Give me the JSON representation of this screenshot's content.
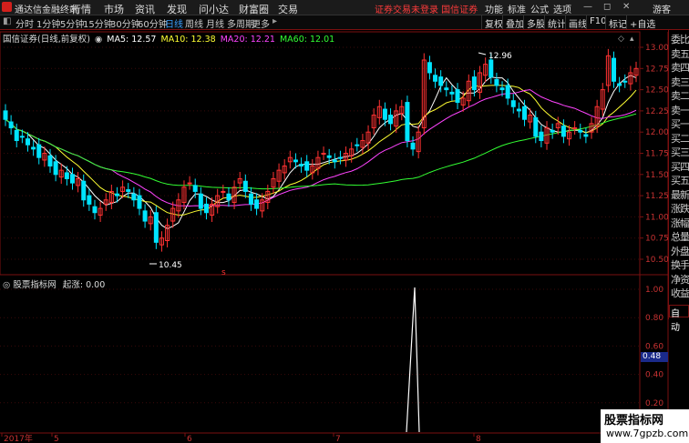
{
  "menubar": {
    "app_name": "通达信金融终端",
    "items": [
      "行情",
      "市场",
      "资讯",
      "发现",
      "问小达",
      "财富圈",
      "交易"
    ],
    "notice": "证券交易未登录 国信证券",
    "right_items": [
      "功能",
      "标准",
      "公式",
      "选项"
    ],
    "user": "游客"
  },
  "toolbar": {
    "timeframes": [
      "分时",
      "1分钟",
      "5分钟",
      "15分钟",
      "30分钟",
      "60分钟",
      "日线",
      "周线",
      "月线",
      "多周期",
      "更多"
    ],
    "active_timeframe": "日线",
    "buttons": [
      "复权",
      "叠加",
      "多股",
      "统计",
      "画线",
      "F10",
      "标记",
      "+自选"
    ]
  },
  "main_chart": {
    "title": "国信证券(日线,前复权)",
    "ma": [
      {
        "label": "MA5: 12.57",
        "color": "#ffffff"
      },
      {
        "label": "MA10: 12.38",
        "color": "#ffff33"
      },
      {
        "label": "MA20: 12.21",
        "color": "#ff44ff"
      },
      {
        "label": "MA60: 12.01",
        "color": "#33ff33"
      }
    ],
    "y_ticks": [
      "13.00",
      "12.75",
      "12.50",
      "12.25",
      "12.00",
      "11.75",
      "11.50",
      "11.25",
      "11.00",
      "10.75",
      "10.50"
    ],
    "high_label": "12.96",
    "low_label": "10.45",
    "marker": "s"
  },
  "indicator": {
    "title": "股票指标网",
    "value_label": "起涨: 0.00",
    "y_ticks": [
      "1.00",
      "0.80",
      "0.60",
      "0.40",
      "0.20"
    ],
    "current_value": "0.48"
  },
  "x_axis": {
    "labels": [
      "2017年",
      "5",
      "6",
      "7",
      "8"
    ]
  },
  "side_panel": {
    "items": [
      "委比",
      "卖五",
      "卖四",
      "卖三",
      "卖二",
      "卖一",
      "买一",
      "买二",
      "买三",
      "买四",
      "买五",
      "最新",
      "涨跌",
      "涨幅",
      "总量",
      "外盘",
      "换手",
      "净资",
      "收益"
    ],
    "auto_label": "自动"
  },
  "watermark": {
    "line1": "股票指标网",
    "line2": "www.7gpzb.com"
  },
  "colors": {
    "up": "#ff3232",
    "down": "#00e4ff",
    "frame": "#7a1010",
    "ma5": "#ffffff",
    "ma10": "#ffff33",
    "ma20": "#ff44ff",
    "ma60": "#33ff33"
  }
}
